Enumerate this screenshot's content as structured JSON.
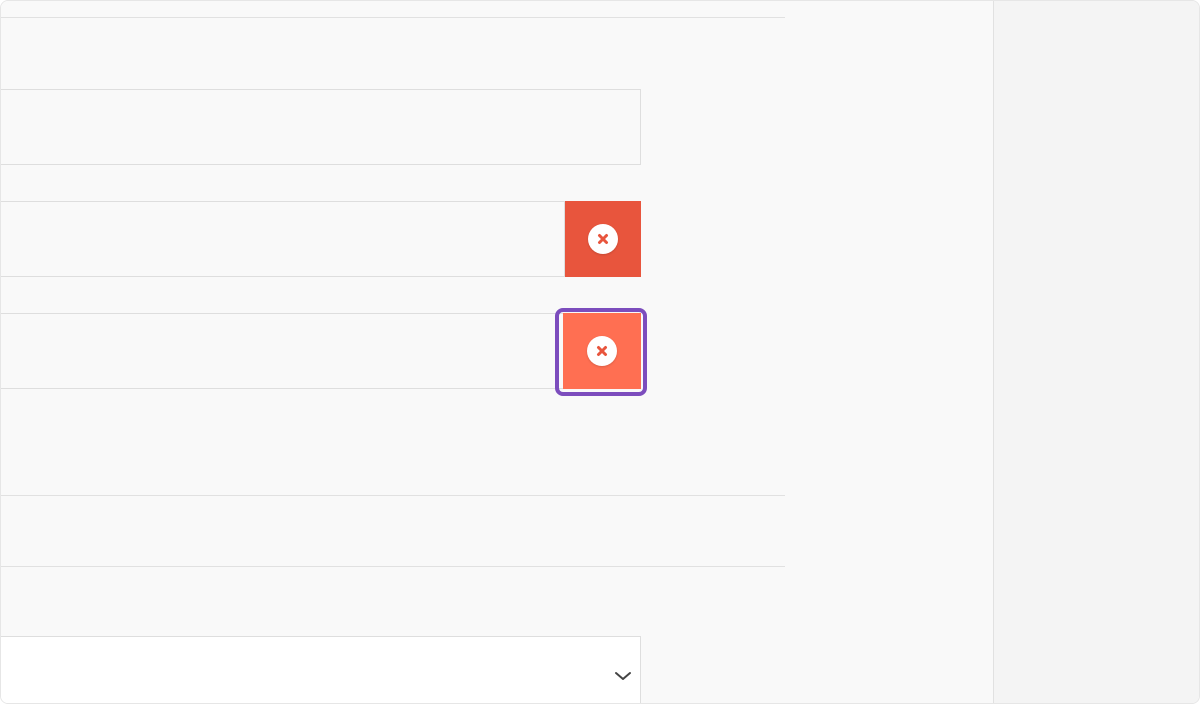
{
  "colors": {
    "remove_button": "#e8553d",
    "remove_button_hover": "#ff6f52",
    "focus_ring": "#7c4dbd",
    "icon_x": "#e8553d"
  },
  "fields": [
    {
      "value": "",
      "placeholder": ""
    },
    {
      "value": "",
      "placeholder": "",
      "remove_icon": "close-circle-icon"
    },
    {
      "value": "",
      "placeholder": "",
      "remove_icon": "close-circle-icon",
      "focused": true
    }
  ],
  "select": {
    "selected": "",
    "icon": "chevron-down-icon"
  }
}
